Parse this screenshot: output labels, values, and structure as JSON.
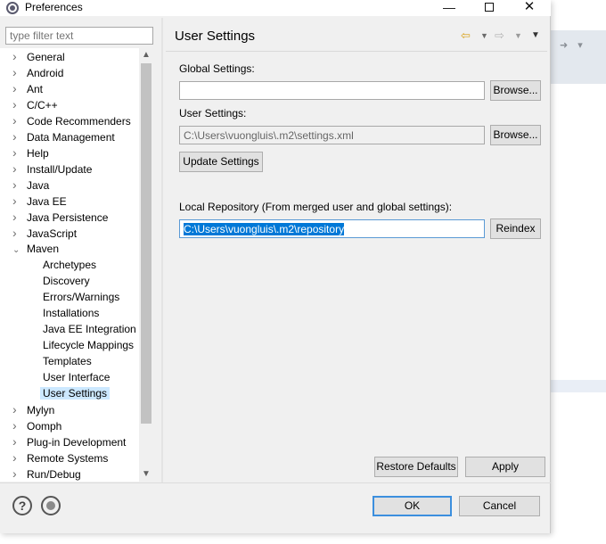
{
  "window": {
    "title": "Preferences",
    "minimize_glyph": "—",
    "close_glyph": "✕"
  },
  "filter": {
    "placeholder": "type filter text"
  },
  "tree": {
    "items": [
      {
        "label": "General",
        "level": 0,
        "expanded": false
      },
      {
        "label": "Android",
        "level": 0,
        "expanded": false
      },
      {
        "label": "Ant",
        "level": 0,
        "expanded": false
      },
      {
        "label": "C/C++",
        "level": 0,
        "expanded": false
      },
      {
        "label": "Code Recommenders",
        "level": 0,
        "expanded": false
      },
      {
        "label": "Data Management",
        "level": 0,
        "expanded": false
      },
      {
        "label": "Help",
        "level": 0,
        "expanded": false
      },
      {
        "label": "Install/Update",
        "level": 0,
        "expanded": false
      },
      {
        "label": "Java",
        "level": 0,
        "expanded": false
      },
      {
        "label": "Java EE",
        "level": 0,
        "expanded": false
      },
      {
        "label": "Java Persistence",
        "level": 0,
        "expanded": false
      },
      {
        "label": "JavaScript",
        "level": 0,
        "expanded": false
      },
      {
        "label": "Maven",
        "level": 0,
        "expanded": true
      },
      {
        "label": "Archetypes",
        "level": 1
      },
      {
        "label": "Discovery",
        "level": 1
      },
      {
        "label": "Errors/Warnings",
        "level": 1
      },
      {
        "label": "Installations",
        "level": 1
      },
      {
        "label": "Java EE Integration",
        "level": 1
      },
      {
        "label": "Lifecycle Mappings",
        "level": 1
      },
      {
        "label": "Templates",
        "level": 1
      },
      {
        "label": "User Interface",
        "level": 1
      },
      {
        "label": "User Settings",
        "level": 1,
        "selected": true
      },
      {
        "label": "Mylyn",
        "level": 0,
        "expanded": false
      },
      {
        "label": "Oomph",
        "level": 0,
        "expanded": false
      },
      {
        "label": "Plug-in Development",
        "level": 0,
        "expanded": false
      },
      {
        "label": "Remote Systems",
        "level": 0,
        "expanded": false
      },
      {
        "label": "Run/Debug",
        "level": 0,
        "expanded": false
      }
    ]
  },
  "page": {
    "title": "User Settings",
    "global_settings_label": "Global Settings:",
    "global_settings_value": "",
    "user_settings_label": "User Settings:",
    "user_settings_value": "C:\\Users\\vuongluis\\.m2\\settings.xml",
    "browse_label": "Browse...",
    "update_settings_label": "Update Settings",
    "local_repo_label": "Local Repository (From merged user and global settings):",
    "local_repo_value": "C:\\Users\\vuongluis\\.m2\\repository",
    "reindex_label": "Reindex",
    "restore_defaults_label": "Restore Defaults",
    "apply_label": "Apply"
  },
  "footer": {
    "help_glyph": "?",
    "ok_label": "OK",
    "cancel_label": "Cancel"
  },
  "colors": {
    "selection": "#0078d7",
    "tree_selected": "#cce8ff",
    "default_button_border": "#3c8fde"
  }
}
